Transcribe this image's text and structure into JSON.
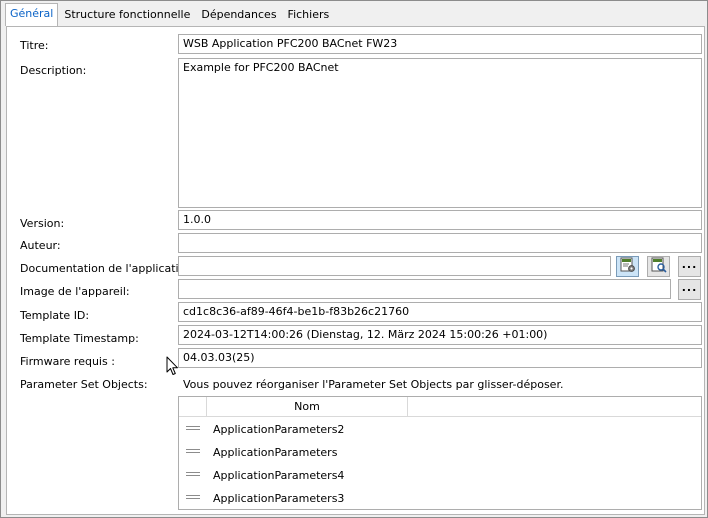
{
  "tabs": [
    "Général",
    "Structure fonctionnelle",
    "Dépendances",
    "Fichiers"
  ],
  "form": {
    "title_label": "Titre:",
    "title_value": "WSB Application PFC200 BACnet FW23",
    "description_label": "Description:",
    "description_value": "Example for PFC200 BACnet",
    "version_label": "Version:",
    "version_value": "1.0.0",
    "author_label": "Auteur:",
    "author_value": "",
    "doc_label": "Documentation de l'application:",
    "doc_value": "",
    "image_label": "Image de l'appareil:",
    "image_value": "",
    "browse_label": "...",
    "template_id_label": "Template ID:",
    "template_id_value": "cd1c8c36-af89-46f4-be1b-f83b26c21760",
    "template_ts_label": "Template Timestamp:",
    "template_ts_value": "2024-03-12T14:00:26 (Dienstag, 12. März 2024 15:00:26 +01:00)",
    "firmware_label": "Firmware requis :",
    "firmware_value": "04.03.03(25)",
    "pso_label": "Parameter Set Objects:",
    "pso_hint": "Vous pouvez réorganiser l'Parameter Set Objects par glisser-déposer."
  },
  "table": {
    "column_header": "Nom",
    "rows": [
      "ApplicationParameters2",
      "ApplicationParameters",
      "ApplicationParameters4",
      "ApplicationParameters3"
    ]
  },
  "icons": {
    "doc_settings": "document-settings-icon",
    "doc_preview": "document-preview-icon",
    "cursor": "mouse-pointer-icon"
  },
  "colors": {
    "active_tab_text": "#0b63c7",
    "selected_button_bg": "#cce4f7",
    "icon_green": "#4f7e2b"
  }
}
